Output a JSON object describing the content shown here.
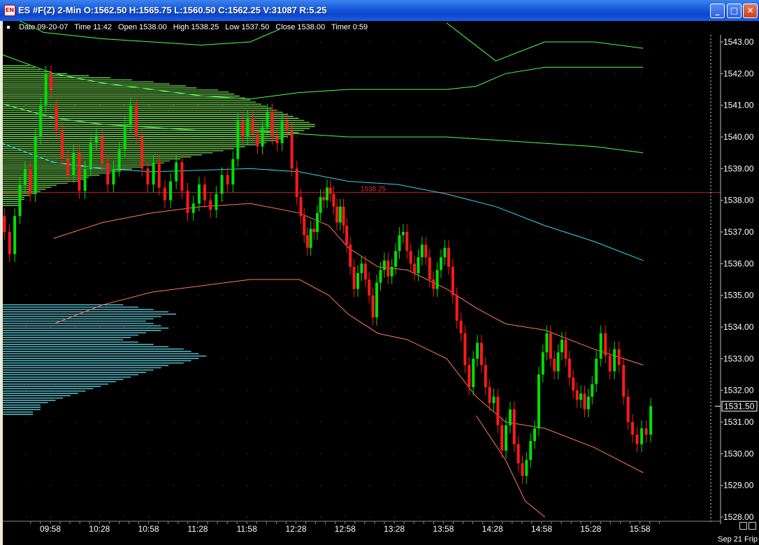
{
  "window": {
    "title": "ES #F(Z) 2-Min O:1562.50 H:1565.75 L:1560.50 C:1562.25 V:31087 R:5.25",
    "icon_label": "EN"
  },
  "info_bar": {
    "date_label": "Date",
    "date": "09-20-07",
    "time_label": "Time",
    "time": "11:42",
    "open_label": "Open",
    "open": "1538.00",
    "high_label": "High",
    "high": "1538.25",
    "low_label": "Low",
    "low": "1537.50",
    "close_label": "Close",
    "close": "1538.00",
    "timer_label": "Timer",
    "timer": "0:59"
  },
  "footer_date": "Sep 21 Frip",
  "colors": {
    "up_candle": "#00e000",
    "down_candle": "#ff1a1a",
    "profile_upper": "#7ee85a",
    "profile_lower": "#5ec8d8",
    "band_green": "#4cff4c",
    "band_blue": "#34d8f0",
    "band_red": "#ff7a5a",
    "poc_line": "#c02020"
  },
  "chart_data": {
    "type": "candlestick",
    "instrument": "ES #F(Z)",
    "interval": "2-Min",
    "x_tick_labels": [
      "09:58",
      "10:28",
      "10:58",
      "11:28",
      "11:58",
      "12:28",
      "12:58",
      "13:28",
      "13:58",
      "14:28",
      "14:58",
      "15:28",
      "15:58"
    ],
    "y_tick_labels": [
      "1543.00",
      "1542.00",
      "1541.00",
      "1540.00",
      "1539.00",
      "1538.00",
      "1537.00",
      "1536.00",
      "1535.00",
      "1534.00",
      "1533.00",
      "1532.00",
      "1531.00",
      "1530.00",
      "1529.00",
      "1528.00"
    ],
    "ylim": [
      1528.0,
      1543.0
    ],
    "last_price": "1531.50",
    "poc_price": 1538.25,
    "poc_label": "1538.25",
    "grid": "dotted",
    "bands": {
      "upper_outer": [
        [
          9.3,
          1544.2
        ],
        [
          9.9,
          1543.3
        ],
        [
          10.5,
          1543.1
        ],
        [
          11.5,
          1542.9
        ],
        [
          12.0,
          1543.0
        ],
        [
          12.3,
          1543.4
        ]
      ],
      "upper_outer_right": [
        [
          14.0,
          1543.6
        ],
        [
          14.5,
          1542.4
        ],
        [
          15.0,
          1543.0
        ],
        [
          15.5,
          1543.0
        ],
        [
          16.0,
          1542.8
        ]
      ],
      "upper_mid": [
        [
          9.3,
          1542.8
        ],
        [
          10.0,
          1542.0
        ],
        [
          10.5,
          1541.7
        ],
        [
          11.0,
          1541.5
        ],
        [
          11.5,
          1541.3
        ],
        [
          12.0,
          1541.2
        ],
        [
          12.5,
          1541.4
        ],
        [
          13.0,
          1541.5
        ],
        [
          13.5,
          1541.5
        ],
        [
          14.0,
          1541.5
        ],
        [
          14.3,
          1541.6
        ],
        [
          14.6,
          1542.0
        ],
        [
          15.0,
          1542.2
        ],
        [
          15.5,
          1542.2
        ],
        [
          16.0,
          1542.2
        ]
      ],
      "upper_inner": [
        [
          9.3,
          1541.2
        ],
        [
          10.0,
          1540.6
        ],
        [
          10.5,
          1540.4
        ],
        [
          11.0,
          1540.3
        ],
        [
          11.5,
          1540.2
        ],
        [
          12.0,
          1540.2
        ],
        [
          12.5,
          1540.1
        ],
        [
          13.0,
          1540.0
        ],
        [
          13.5,
          1540.0
        ],
        [
          14.0,
          1540.0
        ],
        [
          14.5,
          1539.9
        ],
        [
          15.0,
          1539.8
        ],
        [
          15.5,
          1539.7
        ],
        [
          16.0,
          1539.5
        ]
      ],
      "vwap": [
        [
          9.3,
          1540.0
        ],
        [
          10.0,
          1539.2
        ],
        [
          10.5,
          1539.0
        ],
        [
          11.0,
          1538.9
        ],
        [
          11.5,
          1538.95
        ],
        [
          12.0,
          1539.0
        ],
        [
          12.5,
          1538.9
        ],
        [
          13.0,
          1538.6
        ],
        [
          13.5,
          1538.5
        ],
        [
          14.0,
          1538.2
        ],
        [
          14.5,
          1537.8
        ],
        [
          15.0,
          1537.2
        ],
        [
          15.5,
          1536.7
        ],
        [
          16.0,
          1536.1
        ]
      ],
      "lower_inner": [
        [
          10.0,
          1536.8
        ],
        [
          10.5,
          1537.3
        ],
        [
          11.0,
          1537.6
        ],
        [
          11.5,
          1537.8
        ],
        [
          12.0,
          1537.9
        ],
        [
          12.5,
          1537.6
        ],
        [
          12.8,
          1537.2
        ],
        [
          13.0,
          1536.5
        ],
        [
          13.3,
          1535.9
        ],
        [
          13.6,
          1535.8
        ],
        [
          14.0,
          1535.2
        ],
        [
          14.3,
          1534.6
        ],
        [
          14.6,
          1534.1
        ],
        [
          15.0,
          1533.9
        ],
        [
          15.5,
          1533.3
        ],
        [
          16.0,
          1532.8
        ]
      ],
      "lower_mid": [
        [
          10.0,
          1534.1
        ],
        [
          10.5,
          1534.7
        ],
        [
          11.0,
          1535.1
        ],
        [
          11.5,
          1535.3
        ],
        [
          12.0,
          1535.5
        ],
        [
          12.5,
          1535.5
        ],
        [
          12.8,
          1535.0
        ],
        [
          13.0,
          1534.4
        ],
        [
          13.3,
          1533.8
        ],
        [
          13.6,
          1533.6
        ],
        [
          14.0,
          1533.0
        ],
        [
          14.3,
          1531.8
        ],
        [
          14.6,
          1531.0
        ],
        [
          15.0,
          1530.8
        ],
        [
          15.5,
          1530.2
        ],
        [
          16.0,
          1529.4
        ]
      ],
      "lower_outer": [
        [
          14.3,
          1531.2
        ],
        [
          14.6,
          1529.8
        ],
        [
          14.8,
          1528.5
        ],
        [
          15.0,
          1528.0
        ]
      ]
    },
    "price_segments": [
      {
        "start": 9.42,
        "end": 10.0,
        "points": [
          1539.2,
          1537.5,
          1537.0,
          1536.3,
          1537.5,
          1538.5,
          1539.0,
          1538.2,
          1540.0,
          1541.0,
          1542.0,
          1541.5
        ]
      },
      {
        "start": 10.0,
        "end": 11.8,
        "points": [
          1541.0,
          1540.2,
          1539.3,
          1538.8,
          1539.5,
          1538.3,
          1539.0,
          1539.8,
          1540.0,
          1539.2,
          1538.5,
          1539.0,
          1539.6,
          1540.4,
          1541.0,
          1540.0,
          1539.0,
          1538.5,
          1539.2,
          1538.4,
          1538.0,
          1538.6,
          1539.2,
          1538.3,
          1537.6,
          1537.9,
          1538.5,
          1538.0,
          1537.7,
          1538.2,
          1538.8,
          1538.5
        ]
      },
      {
        "start": 11.8,
        "end": 12.5,
        "points": [
          1538.5,
          1539.3,
          1540.5,
          1540.0,
          1540.6,
          1540.1,
          1539.7,
          1540.3,
          1540.8,
          1540.0,
          1539.8,
          1540.5,
          1540.2,
          1539.0,
          1538.1
        ]
      },
      {
        "start": 12.5,
        "end": 13.0,
        "points": [
          1538.1,
          1537.5,
          1536.9,
          1536.5,
          1537.1,
          1537.0,
          1537.6,
          1538.1,
          1538.0,
          1538.4,
          1538.2,
          1537.8,
          1537.3,
          1537.8,
          1537.2,
          1536.6
        ]
      },
      {
        "start": 13.0,
        "end": 13.5,
        "points": [
          1536.6,
          1535.9,
          1535.2,
          1535.7,
          1536.0,
          1535.5,
          1535.0,
          1534.3,
          1535.4,
          1535.8,
          1536.1,
          1535.6,
          1535.9,
          1536.4
        ]
      },
      {
        "start": 13.5,
        "end": 14.0,
        "points": [
          1536.4,
          1536.9,
          1537.0,
          1536.4,
          1536.0,
          1535.7,
          1536.2,
          1536.6,
          1536.2,
          1535.5,
          1535.2,
          1535.8,
          1536.2,
          1536.5
        ]
      },
      {
        "start": 14.0,
        "end": 14.5,
        "points": [
          1536.5,
          1535.9,
          1535.0,
          1534.2,
          1533.8,
          1532.8,
          1532.1,
          1533.0,
          1533.5,
          1532.8,
          1532.1,
          1531.6,
          1531.8
        ]
      },
      {
        "start": 14.5,
        "end": 15.0,
        "points": [
          1531.8,
          1530.9,
          1530.1,
          1530.9,
          1531.4,
          1530.3,
          1529.7,
          1529.3,
          1529.8,
          1530.4,
          1530.8,
          1532.5,
          1533.2
        ]
      },
      {
        "start": 15.0,
        "end": 15.5,
        "points": [
          1533.2,
          1533.8,
          1533.0,
          1532.6,
          1533.2,
          1533.6,
          1533.0,
          1532.4,
          1532.0,
          1531.7,
          1531.9,
          1531.4,
          1531.8,
          1532.2
        ]
      },
      {
        "start": 15.5,
        "end": 16.1,
        "points": [
          1532.2,
          1533.0,
          1533.8,
          1533.1,
          1532.6,
          1533.3,
          1532.8,
          1531.8,
          1531.0,
          1530.6,
          1530.3,
          1530.8,
          1530.6,
          1531.5
        ]
      }
    ],
    "profile_upper_widths": [
      0.05,
      0.06,
      0.07,
      0.09,
      0.12,
      0.16,
      0.2,
      0.24,
      0.28,
      0.31,
      0.34,
      0.36,
      0.4,
      0.42,
      0.43,
      0.44,
      0.45,
      0.46,
      0.47,
      0.48,
      0.49,
      0.5,
      0.51,
      0.52,
      0.53,
      0.54,
      0.55,
      0.56,
      0.57,
      0.58,
      0.58,
      0.57,
      0.56,
      0.55,
      0.54,
      0.53,
      0.52,
      0.51,
      0.49,
      0.47,
      0.45,
      0.43,
      0.41,
      0.39,
      0.37,
      0.35,
      0.33,
      0.31,
      0.3,
      0.28,
      0.26,
      0.24,
      0.22,
      0.2,
      0.18,
      0.16,
      0.15,
      0.14,
      0.12,
      0.1,
      0.09,
      0.08,
      0.07,
      0.06,
      0.05,
      0.04,
      0.04,
      0.03,
      0.03,
      0.03
    ],
    "profile_lower_widths": [
      0.16,
      0.18,
      0.2,
      0.22,
      0.23,
      0.21,
      0.2,
      0.19,
      0.2,
      0.21,
      0.22,
      0.21,
      0.19,
      0.18,
      0.17,
      0.16,
      0.18,
      0.2,
      0.22,
      0.24,
      0.25,
      0.26,
      0.27,
      0.26,
      0.25,
      0.24,
      0.22,
      0.21,
      0.2,
      0.19,
      0.18,
      0.17,
      0.16,
      0.15,
      0.14,
      0.13,
      0.12,
      0.11,
      0.1,
      0.09,
      0.08,
      0.07,
      0.06,
      0.05,
      0.05,
      0.05,
      0.04,
      0.04
    ]
  }
}
